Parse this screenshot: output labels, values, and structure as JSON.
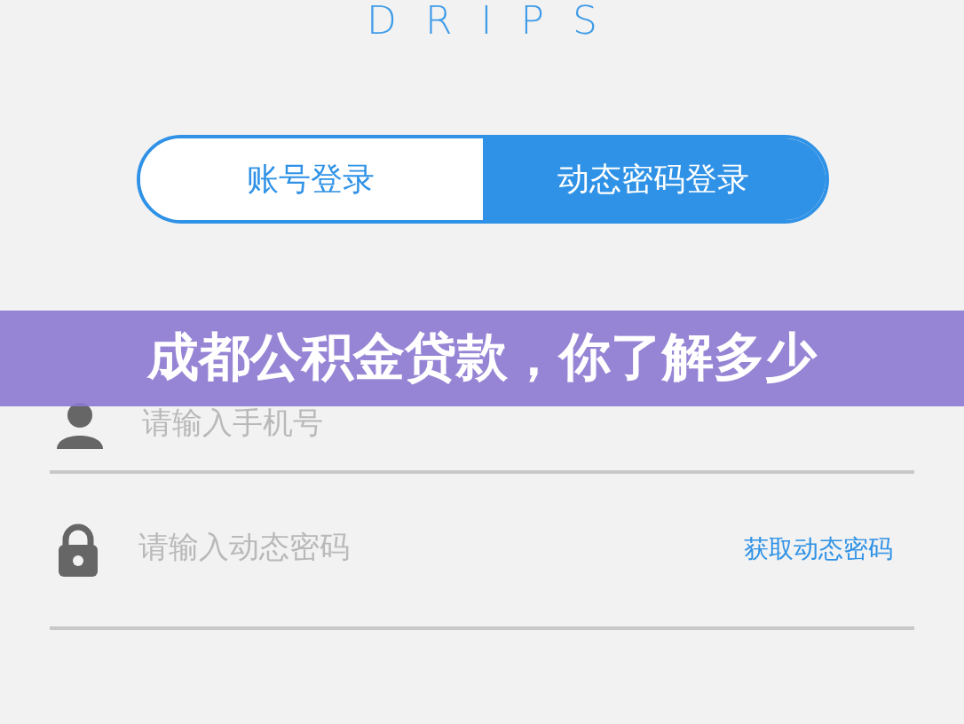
{
  "logo": "DRIPS",
  "tabs": [
    {
      "label": "账号登录",
      "selected": false
    },
    {
      "label": "动态密码登录",
      "selected": true
    }
  ],
  "fields": [
    {
      "kind": "phone",
      "placeholder": "请输入手机号"
    },
    {
      "kind": "code",
      "placeholder": "请输入动态密码",
      "action": "获取动态密码"
    }
  ],
  "banner": {
    "title": "成都公积金贷款，你了解多少"
  }
}
